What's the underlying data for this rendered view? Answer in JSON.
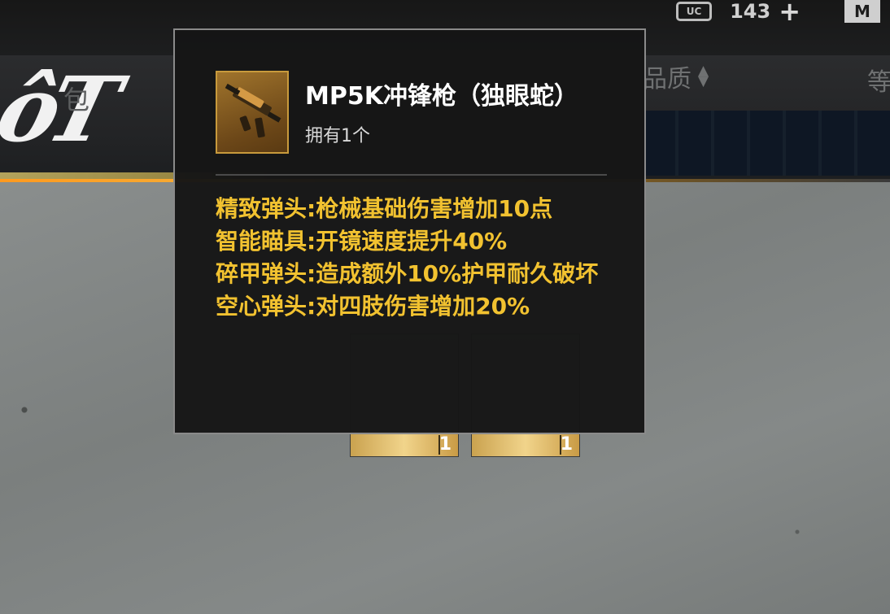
{
  "currency": {
    "amount": "143",
    "icon_label": "UC",
    "add_label": "+",
    "badge_label": "M"
  },
  "header": {
    "tab_bag_label": "包",
    "sort_quality_label": "品质",
    "sort_level_label": "等",
    "logo_text": "ôT"
  },
  "item_cards": [
    {
      "count": "1"
    },
    {
      "count": "1"
    }
  ],
  "tooltip": {
    "title": "MP5K冲锋枪（独眼蛇）",
    "owned": "拥有1个",
    "attachments": [
      "精致弹头:枪械基础伤害增加10点",
      "智能瞄具:开镜速度提升40%",
      "碎甲弹头:造成额外10%护甲耐久破坏",
      "空心弹头:对四肢伤害增加20%"
    ]
  },
  "colors": {
    "accent_gold": "#f2c230",
    "accent_orange": "#ff9a1f",
    "tooltip_border": "#8a8a8a"
  }
}
